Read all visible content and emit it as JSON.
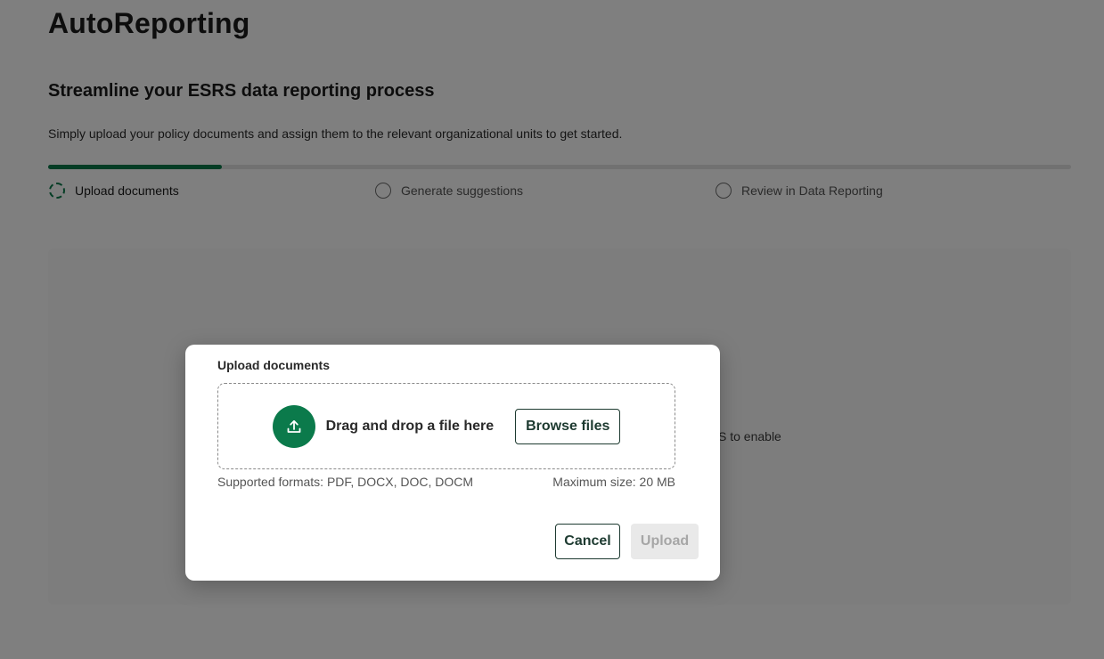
{
  "app": {
    "title": "AutoReporting"
  },
  "main": {
    "subtitle": "Streamline your ESRS data reporting process",
    "description": "Simply upload your policy documents and assign them to the relevant organizational units to get started.",
    "progress_fraction": 0.17,
    "steps": [
      {
        "label": "Upload documents",
        "state": "active"
      },
      {
        "label": "Generate suggestions",
        "state": "pending"
      },
      {
        "label": "Review in Data Reporting",
        "state": "pending"
      }
    ],
    "obscured_text": "S to enable"
  },
  "modal": {
    "title": "Upload documents",
    "drop_text": "Drag and drop a file here",
    "browse_label": "Browse files",
    "formats": "Supported formats: PDF, DOCX, DOC, DOCM",
    "max_size": "Maximum size: 20 MB",
    "cancel_label": "Cancel",
    "upload_label": "Upload"
  },
  "icons": {
    "upload": "upload-arrow-icon",
    "step_active": "dashed-circle-icon",
    "step_pending": "circle-icon"
  },
  "colors": {
    "accent": "#0b7a4b",
    "button_border": "#1d3a30",
    "disabled_bg": "#e9e9e9",
    "disabled_text": "#a6a6a6"
  }
}
